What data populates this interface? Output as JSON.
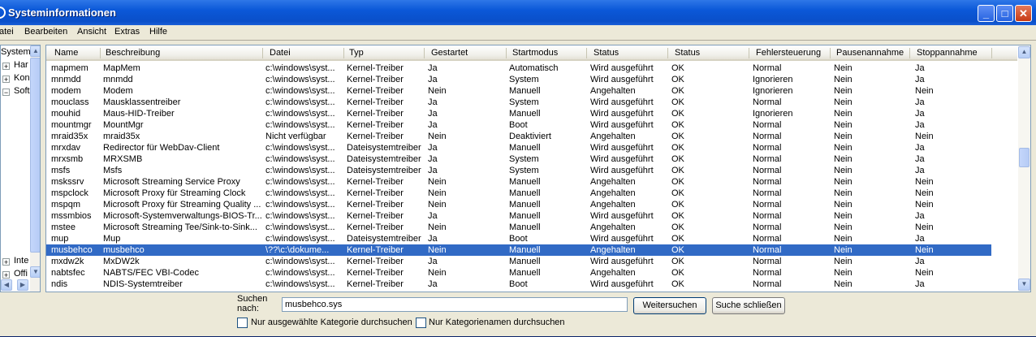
{
  "window": {
    "title": "Systeminformationen",
    "controls": {
      "minimize": "_",
      "maximize": "□",
      "close": "✕"
    }
  },
  "menu": [
    "atei",
    "Bearbeiten",
    "Ansicht",
    "Extras",
    "Hilfe"
  ],
  "tree": {
    "items": [
      {
        "label": "Systemü",
        "expander": ""
      },
      {
        "label": "Har",
        "expander": "+"
      },
      {
        "label": "Kon",
        "expander": "+"
      },
      {
        "label": "Soft",
        "expander": "−"
      },
      {
        "label": "Inte",
        "expander": "+"
      },
      {
        "label": "Offi",
        "expander": "+"
      }
    ]
  },
  "table": {
    "columns": [
      "Name",
      "Beschreibung",
      "Datei",
      "Typ",
      "Gestartet",
      "Startmodus",
      "Status",
      "Status",
      "Fehlersteuerung",
      "Pausenannahme",
      "Stoppannahme"
    ],
    "rows": [
      [
        "mapmem",
        "MapMem",
        "c:\\windows\\syst...",
        "Kernel-Treiber",
        "Ja",
        "Automatisch",
        "Wird ausgeführt",
        "OK",
        "Normal",
        "Nein",
        "Ja"
      ],
      [
        "mnmdd",
        "mnmdd",
        "c:\\windows\\syst...",
        "Kernel-Treiber",
        "Ja",
        "System",
        "Wird ausgeführt",
        "OK",
        "Ignorieren",
        "Nein",
        "Ja"
      ],
      [
        "modem",
        "Modem",
        "c:\\windows\\syst...",
        "Kernel-Treiber",
        "Nein",
        "Manuell",
        "Angehalten",
        "OK",
        "Ignorieren",
        "Nein",
        "Nein"
      ],
      [
        "mouclass",
        "Mausklassentreiber",
        "c:\\windows\\syst...",
        "Kernel-Treiber",
        "Ja",
        "System",
        "Wird ausgeführt",
        "OK",
        "Normal",
        "Nein",
        "Ja"
      ],
      [
        "mouhid",
        "Maus-HID-Treiber",
        "c:\\windows\\syst...",
        "Kernel-Treiber",
        "Ja",
        "Manuell",
        "Wird ausgeführt",
        "OK",
        "Ignorieren",
        "Nein",
        "Ja"
      ],
      [
        "mountmgr",
        "MountMgr",
        "c:\\windows\\syst...",
        "Kernel-Treiber",
        "Ja",
        "Boot",
        "Wird ausgeführt",
        "OK",
        "Normal",
        "Nein",
        "Ja"
      ],
      [
        "mraid35x",
        "mraid35x",
        "Nicht verfügbar",
        "Kernel-Treiber",
        "Nein",
        "Deaktiviert",
        "Angehalten",
        "OK",
        "Normal",
        "Nein",
        "Nein"
      ],
      [
        "mrxdav",
        "Redirector für WebDav-Client",
        "c:\\windows\\syst...",
        "Dateisystemtreiber",
        "Ja",
        "Manuell",
        "Wird ausgeführt",
        "OK",
        "Normal",
        "Nein",
        "Ja"
      ],
      [
        "mrxsmb",
        "MRXSMB",
        "c:\\windows\\syst...",
        "Dateisystemtreiber",
        "Ja",
        "System",
        "Wird ausgeführt",
        "OK",
        "Normal",
        "Nein",
        "Ja"
      ],
      [
        "msfs",
        "Msfs",
        "c:\\windows\\syst...",
        "Dateisystemtreiber",
        "Ja",
        "System",
        "Wird ausgeführt",
        "OK",
        "Normal",
        "Nein",
        "Ja"
      ],
      [
        "mskssrv",
        "Microsoft Streaming Service Proxy",
        "c:\\windows\\syst...",
        "Kernel-Treiber",
        "Nein",
        "Manuell",
        "Angehalten",
        "OK",
        "Normal",
        "Nein",
        "Nein"
      ],
      [
        "mspclock",
        "Microsoft Proxy für Streaming Clock",
        "c:\\windows\\syst...",
        "Kernel-Treiber",
        "Nein",
        "Manuell",
        "Angehalten",
        "OK",
        "Normal",
        "Nein",
        "Nein"
      ],
      [
        "mspqm",
        "Microsoft Proxy für Streaming Quality ...",
        "c:\\windows\\syst...",
        "Kernel-Treiber",
        "Nein",
        "Manuell",
        "Angehalten",
        "OK",
        "Normal",
        "Nein",
        "Nein"
      ],
      [
        "mssmbios",
        "Microsoft-Systemverwaltungs-BIOS-Tr...",
        "c:\\windows\\syst...",
        "Kernel-Treiber",
        "Ja",
        "Manuell",
        "Wird ausgeführt",
        "OK",
        "Normal",
        "Nein",
        "Ja"
      ],
      [
        "mstee",
        "Microsoft Streaming Tee/Sink-to-Sink...",
        "c:\\windows\\syst...",
        "Kernel-Treiber",
        "Nein",
        "Manuell",
        "Angehalten",
        "OK",
        "Normal",
        "Nein",
        "Nein"
      ],
      [
        "mup",
        "Mup",
        "c:\\windows\\syst...",
        "Dateisystemtreiber",
        "Ja",
        "Boot",
        "Wird ausgeführt",
        "OK",
        "Normal",
        "Nein",
        "Ja"
      ],
      [
        "musbehco",
        "musbehco",
        "\\??\\c:\\dokume...",
        "Kernel-Treiber",
        "Nein",
        "Manuell",
        "Angehalten",
        "OK",
        "Normal",
        "Nein",
        "Nein"
      ],
      [
        "mxdw2k",
        "MxDW2k",
        "c:\\windows\\syst...",
        "Kernel-Treiber",
        "Ja",
        "Manuell",
        "Wird ausgeführt",
        "OK",
        "Normal",
        "Nein",
        "Ja"
      ],
      [
        "nabtsfec",
        "NABTS/FEC VBI-Codec",
        "c:\\windows\\syst...",
        "Kernel-Treiber",
        "Nein",
        "Manuell",
        "Angehalten",
        "OK",
        "Normal",
        "Nein",
        "Nein"
      ],
      [
        "ndis",
        "NDIS-Systemtreiber",
        "c:\\windows\\syst...",
        "Kernel-Treiber",
        "Ja",
        "Boot",
        "Wird ausgeführt",
        "OK",
        "Normal",
        "Nein",
        "Ja"
      ]
    ],
    "selected_index": 16
  },
  "search": {
    "label": "Suchen nach:",
    "value": "musbehco.sys",
    "next_button": "Weitersuchen",
    "close_button": "Suche schließen",
    "opt_selected_category": "Nur ausgewählte Kategorie durchsuchen",
    "opt_category_names": "Nur Kategorienamen durchsuchen"
  }
}
